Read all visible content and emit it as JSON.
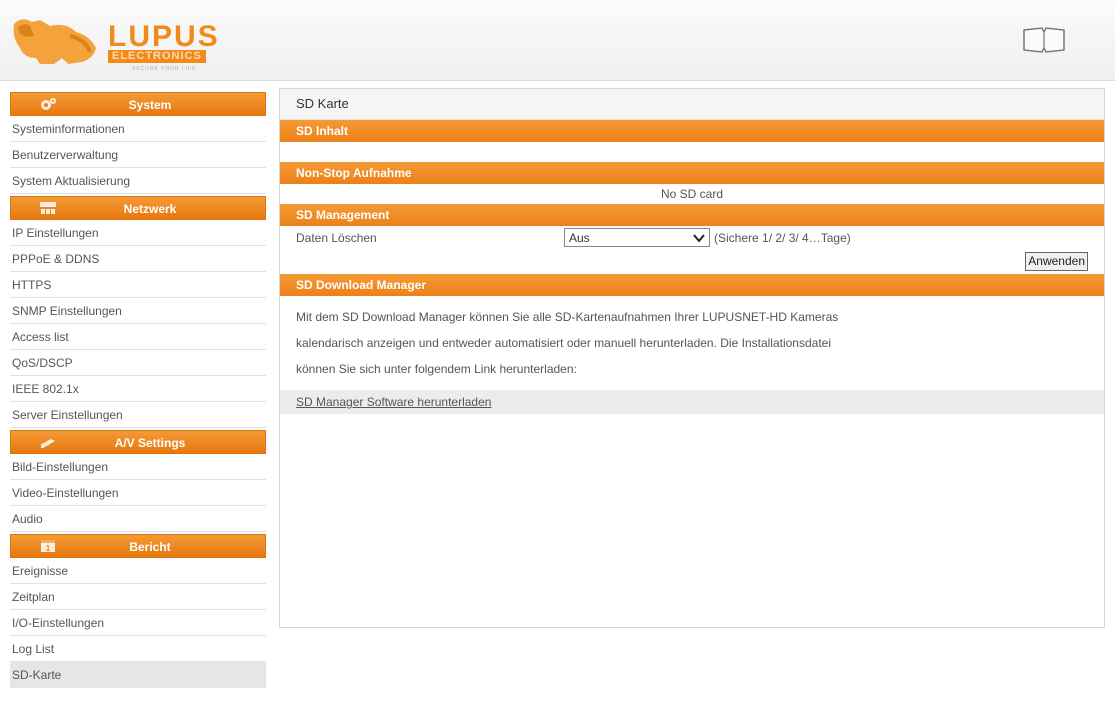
{
  "header": {
    "logo_text": "LUPUS",
    "logo_sub": "ELECTRONICS",
    "logo_tag": "SECURE YOUR LIFE",
    "manual_icon": "book-icon"
  },
  "sidebar": {
    "groups": [
      {
        "title": "System",
        "icon": "gear-icon",
        "items": [
          "Systeminformationen",
          "Benutzerverwaltung",
          "System Aktualisierung"
        ]
      },
      {
        "title": "Netzwerk",
        "icon": "network-icon",
        "items": [
          "IP Einstellungen",
          "PPPoE & DDNS",
          "HTTPS",
          "SNMP Einstellungen",
          "Access list",
          "QoS/DSCP",
          "IEEE 802.1x",
          "Server Einstellungen"
        ]
      },
      {
        "title": "A/V Settings",
        "icon": "camera-icon",
        "items": [
          "Bild-Einstellungen",
          "Video-Einstellungen",
          "Audio"
        ]
      },
      {
        "title": "Bericht",
        "icon": "calendar-icon",
        "items": [
          "Ereignisse",
          "Zeitplan",
          "I/O-Einstellungen",
          "Log List",
          "SD-Karte"
        ]
      }
    ],
    "active_item": "SD-Karte"
  },
  "main": {
    "title": "SD Karte",
    "sections": {
      "sd_inhalt": "SD Inhalt",
      "non_stop": "Non-Stop Aufnahme",
      "no_card": "No SD card",
      "management": "SD Management",
      "delete_label": "Daten Löschen",
      "delete_value": "Aus",
      "delete_hint": "(Sichere 1/ 2/ 3/ 4…Tage)",
      "apply_button": "Anwenden",
      "download_manager": "SD Download Manager",
      "description_lines": [
        "Mit dem SD Download Manager können Sie alle SD-Kartenaufnahmen Ihrer LUPUSNET-HD Kameras",
        "kalendarisch anzeigen und entweder automatisiert oder manuell herunterladen. Die Installationsdatei",
        "können Sie sich unter folgendem Link herunterladen:"
      ],
      "download_link": "SD Manager Software herunterladen"
    }
  },
  "colors": {
    "accent": "#ec8118",
    "accent_light": "#f59a36",
    "active_item_bg": "#e6e6e6"
  }
}
